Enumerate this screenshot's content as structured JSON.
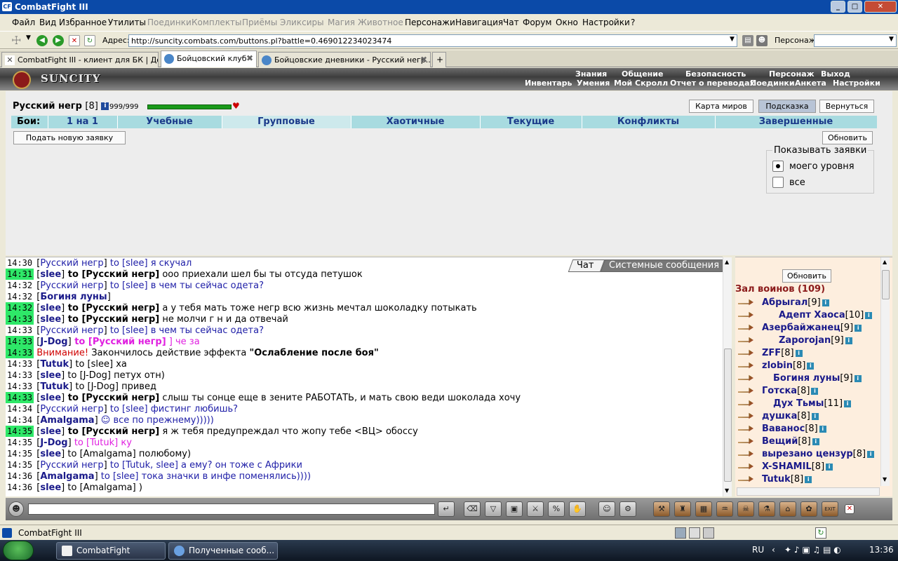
{
  "window": {
    "title": "CombatFight III"
  },
  "menu": {
    "items": [
      {
        "label": "Файл",
        "enabled": true
      },
      {
        "label": "Вид",
        "enabled": true
      },
      {
        "label": "Избранное",
        "enabled": true
      },
      {
        "label": "Утилиты",
        "enabled": true
      },
      {
        "label": "Поединки",
        "enabled": false
      },
      {
        "label": "Комплекты",
        "enabled": false
      },
      {
        "label": "Приёмы",
        "enabled": false
      },
      {
        "label": "Эликсиры",
        "enabled": false
      },
      {
        "label": "Магия",
        "enabled": false
      },
      {
        "label": "Животное",
        "enabled": false
      },
      {
        "label": "Персонажи",
        "enabled": true
      },
      {
        "label": "Навигация",
        "enabled": true
      },
      {
        "label": "Чат",
        "enabled": true
      },
      {
        "label": "Форум",
        "enabled": true
      },
      {
        "label": "Окно",
        "enabled": true
      },
      {
        "label": "Настройки",
        "enabled": true
      },
      {
        "label": "?",
        "enabled": true
      }
    ]
  },
  "address": {
    "label": "Адрес:",
    "url": "http://suncity.combats.com/buttons.pl?battle=0.469012234023474",
    "persona_label": "Персонаж:"
  },
  "tabs": [
    {
      "label": "CombatFight III - клиент для БК | До...",
      "active": false
    },
    {
      "label": "Бойцовский клуб",
      "active": true
    },
    {
      "label": "Бойцовские дневники - Русский негр...",
      "active": false
    }
  ],
  "game_header": {
    "logo": "SUNCITY",
    "nav_top": [
      "Знания",
      "Общение",
      "Безопасность",
      "Персонаж",
      "Выход"
    ],
    "nav_bottom": [
      "Инвентарь",
      "Умения",
      "Мой Скролл",
      "Отчет о переводах",
      "Поединки",
      "Анкета",
      "Настройки"
    ]
  },
  "character": {
    "name": "Русский негр",
    "level": "[8]",
    "info_icon": "i",
    "hp": "999/999",
    "hp_fraction": 1.0
  },
  "top_buttons": {
    "map": "Карта миров",
    "hint": "Подсказка",
    "back": "Вернуться"
  },
  "battles": {
    "label": "Бои:",
    "tabs": [
      "1 на 1",
      "Учебные",
      "Групповые",
      "Хаотичные",
      "Текущие",
      "Конфликты",
      "Завершенные"
    ],
    "active_index": 2
  },
  "actions": {
    "new_request": "Подать новую заявку",
    "refresh": "Обновить"
  },
  "show_requests": {
    "legend": "Показывать заявки",
    "options": [
      {
        "label": "моего уровня",
        "checked": true
      },
      {
        "label": "все",
        "checked": false
      }
    ]
  },
  "chat": {
    "tabs": [
      "Чат",
      "Системные сообщения"
    ],
    "lines": [
      {
        "time": "14:30",
        "hl": false,
        "parts": [
          [
            "Русский негр",
            "nickb"
          ],
          [
            " to [slee] я скучал",
            "blue"
          ]
        ]
      },
      {
        "time": "14:31",
        "hl": true,
        "parts": [
          [
            "slee",
            "nick"
          ],
          [
            " to [Русский негр]",
            "bold"
          ],
          [
            " ооо приехали шел бы ты отсуда петушок",
            ""
          ]
        ]
      },
      {
        "time": "14:32",
        "hl": false,
        "parts": [
          [
            "Русский негр",
            "nickb"
          ],
          [
            " to [slee] в чем ты сейчас одета?",
            "blue"
          ]
        ]
      },
      {
        "time": "14:32",
        "hl": false,
        "parts": [
          [
            "Богиня луны",
            "nick"
          ],
          [
            " ",
            ""
          ]
        ]
      },
      {
        "time": "14:32",
        "hl": true,
        "parts": [
          [
            "slee",
            "nick"
          ],
          [
            " to [Русский негр]",
            "bold"
          ],
          [
            " а у тебя мать тоже негр всю жизнь мечтал шоколадку потыкать",
            ""
          ]
        ]
      },
      {
        "time": "14:33",
        "hl": true,
        "parts": [
          [
            "slee",
            "nick"
          ],
          [
            " to [Русский негр]",
            "bold"
          ],
          [
            " не молчи г н и да отвечай",
            ""
          ]
        ]
      },
      {
        "time": "14:33",
        "hl": false,
        "parts": [
          [
            "Русский негр",
            "nickb"
          ],
          [
            " to [slee] в чем ты сейчас одета?",
            "blue"
          ]
        ]
      },
      {
        "time": "14:33",
        "hl": true,
        "parts": [
          [
            "J-Dog",
            "nick"
          ],
          [
            " to [Русский негр]",
            "magb"
          ],
          [
            " ] че за",
            "mag"
          ]
        ]
      },
      {
        "time": "14:33",
        "hl": true,
        "parts": [
          [
            "Внимание!",
            "red"
          ],
          [
            " Закончилось действие эффекта ",
            ""
          ],
          [
            "\"Ослабление после боя\"",
            "bold"
          ]
        ]
      },
      {
        "time": "14:33",
        "hl": false,
        "parts": [
          [
            "Tutuk",
            "nick"
          ],
          [
            " to [slee] ха",
            ""
          ]
        ]
      },
      {
        "time": "14:33",
        "hl": false,
        "parts": [
          [
            "slee",
            "nick"
          ],
          [
            " to [J-Dog] петух отн)",
            ""
          ]
        ]
      },
      {
        "time": "14:33",
        "hl": false,
        "parts": [
          [
            "Tutuk",
            "nick"
          ],
          [
            " to [J-Dog] привед",
            ""
          ]
        ]
      },
      {
        "time": "14:33",
        "hl": true,
        "parts": [
          [
            "slee",
            "nick"
          ],
          [
            " to [Русский негр]",
            "bold"
          ],
          [
            " слыш ты сонце еще в зените РАБОТАТЬ, и мать свою веди шоколада хочу",
            ""
          ]
        ]
      },
      {
        "time": "14:34",
        "hl": false,
        "parts": [
          [
            "Русский негр",
            "nickb"
          ],
          [
            " to [slee] фистинг любишь?",
            "blue"
          ]
        ]
      },
      {
        "time": "14:34",
        "hl": false,
        "parts": [
          [
            "Amalgama",
            "nick"
          ],
          [
            " ☺ все по прежнему)))))",
            "blue"
          ]
        ]
      },
      {
        "time": "14:35",
        "hl": true,
        "parts": [
          [
            "slee",
            "nick"
          ],
          [
            " to [Русский негр]",
            "bold"
          ],
          [
            " я ж тебя предупреждал что жопу тебе <ВЦ> обоссу",
            ""
          ]
        ]
      },
      {
        "time": "14:35",
        "hl": false,
        "parts": [
          [
            "J-Dog",
            "nick"
          ],
          [
            " to [Tutuk] ку",
            "mag"
          ]
        ]
      },
      {
        "time": "14:35",
        "hl": false,
        "parts": [
          [
            "slee",
            "nick"
          ],
          [
            " to [Amalgama] полюбому)",
            ""
          ]
        ]
      },
      {
        "time": "14:35",
        "hl": false,
        "parts": [
          [
            "Русский негр",
            "nickb"
          ],
          [
            " to [Tutuk, slee] а ему? он тоже с Африки",
            "blue"
          ]
        ]
      },
      {
        "time": "14:36",
        "hl": false,
        "parts": [
          [
            "Amalgama",
            "nick"
          ],
          [
            " to [slee] тока значки в инфе поменялись))))",
            "blue"
          ]
        ]
      },
      {
        "time": "14:36",
        "hl": false,
        "parts": [
          [
            "slee",
            "nick"
          ],
          [
            " to [Amalgama] )",
            ""
          ]
        ]
      }
    ]
  },
  "warriors": {
    "refresh": "Обновить",
    "title": "Зал воинов (109)",
    "list": [
      {
        "name": "Абрыгал",
        "level": "[9]"
      },
      {
        "name": "Адепт Хаоса",
        "level": "[10]"
      },
      {
        "name": "Азербайжанец",
        "level": "[9]"
      },
      {
        "name": "Zaporojan",
        "level": "[9]"
      },
      {
        "name": "ZFF",
        "level": "[8]"
      },
      {
        "name": "zlobin",
        "level": "[8]"
      },
      {
        "name": "Богиня луны",
        "level": "[9]"
      },
      {
        "name": "Готска",
        "level": "[8]"
      },
      {
        "name": "Дух Тьмы",
        "level": "[11]"
      },
      {
        "name": "душка",
        "level": "[8]"
      },
      {
        "name": "Ваванос",
        "level": "[8]"
      },
      {
        "name": "Вещий",
        "level": "[8]"
      },
      {
        "name": "вырезано цензур",
        "level": "[8]"
      },
      {
        "name": "X-SHAMIL",
        "level": "[8]"
      },
      {
        "name": "Tutuk",
        "level": "[8]"
      }
    ]
  },
  "statusbar": {
    "title": "CombatFight III"
  },
  "taskbar": {
    "items": [
      "CombatFight",
      "Полученные сооб..."
    ],
    "lang": "RU",
    "clock": "13:36"
  },
  "colors": {
    "highlight": "#2ee868",
    "battle_tab_bg": "#a8dbe0",
    "warriors_bg": "#fdeede"
  }
}
